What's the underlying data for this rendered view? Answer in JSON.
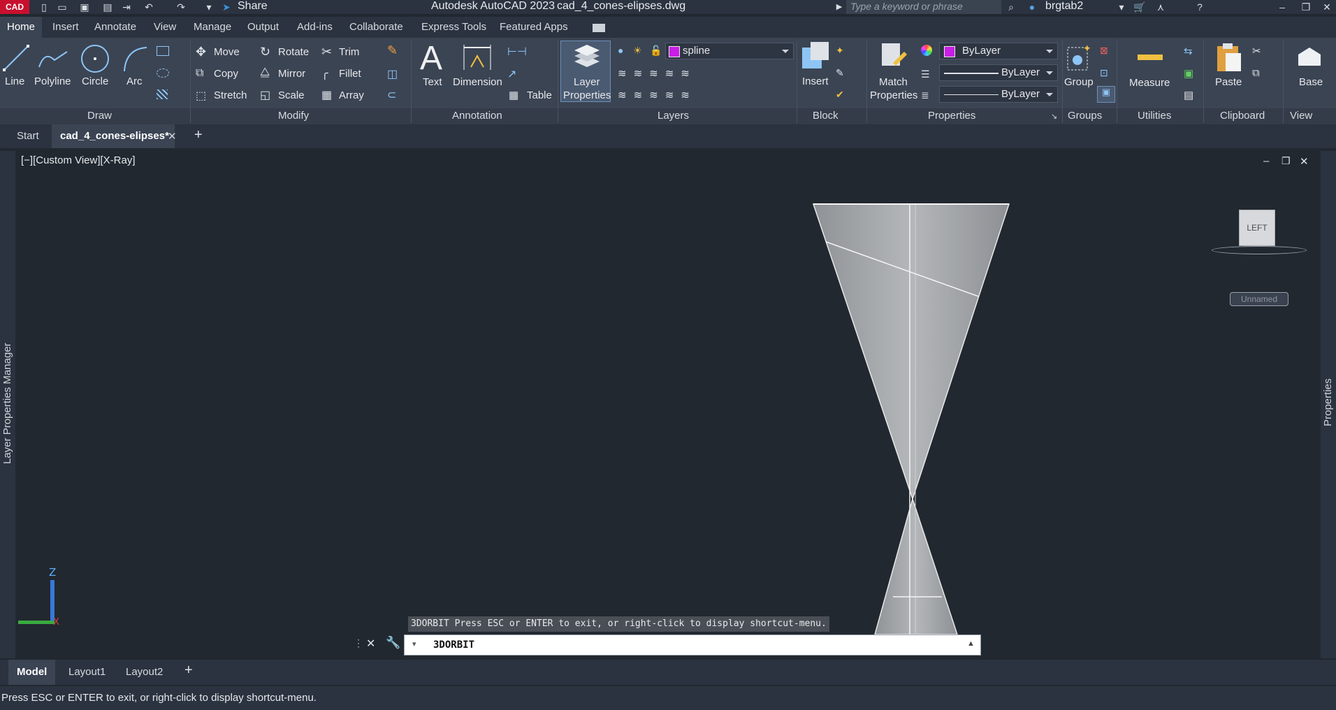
{
  "app": {
    "logo": "CAD",
    "title": "Autodesk AutoCAD 2023",
    "filename": "cad_4_cones-elipses.dwg",
    "share_label": "Share",
    "search_placeholder": "Type a keyword or phrase",
    "username": "brgtab2"
  },
  "ribbon_tabs": [
    "Home",
    "Insert",
    "Annotate",
    "View",
    "Manage",
    "Output",
    "Add-ins",
    "Collaborate",
    "Express Tools",
    "Featured Apps"
  ],
  "draw": {
    "line": "Line",
    "polyline": "Polyline",
    "circle": "Circle",
    "arc": "Arc",
    "panel": "Draw"
  },
  "modify": {
    "move": "Move",
    "rotate": "Rotate",
    "trim": "Trim",
    "copy": "Copy",
    "mirror": "Mirror",
    "fillet": "Fillet",
    "stretch": "Stretch",
    "scale": "Scale",
    "array": "Array",
    "panel": "Modify"
  },
  "annotation": {
    "text": "Text",
    "dimension": "Dimension",
    "table": "Table",
    "panel": "Annotation"
  },
  "layers": {
    "layer_properties_1": "Layer",
    "layer_properties_2": "Properties",
    "current_layer": "spline",
    "panel": "Layers"
  },
  "block": {
    "insert": "Insert",
    "panel": "Block"
  },
  "properties": {
    "match_1": "Match",
    "match_2": "Properties",
    "color": "ByLayer",
    "linetype": "ByLayer",
    "lineweight": "ByLayer",
    "panel": "Properties"
  },
  "groups": {
    "group": "Group",
    "panel": "Groups"
  },
  "utilities": {
    "measure": "Measure",
    "panel": "Utilities"
  },
  "clipboard": {
    "paste": "Paste",
    "panel": "Clipboard"
  },
  "view_panel": {
    "base": "Base",
    "panel": "View"
  },
  "file_tabs": {
    "start": "Start",
    "active": "cad_4_cones-elipses*"
  },
  "viewport": {
    "label": "[−][Custom View][X-Ray]",
    "viewcube_face": "LEFT",
    "ucs_name": "Unnamed",
    "axis_z": "Z",
    "left_palette": "Layer Properties Manager",
    "right_palette": "Properties"
  },
  "command": {
    "prompt_history": "3DORBIT Press ESC or ENTER to exit, or right-click to display shortcut-menu.",
    "current": "3DORBIT"
  },
  "layout_tabs": [
    "Model",
    "Layout1",
    "Layout2"
  ],
  "status_text": "Press ESC or ENTER to exit, or right-click to display shortcut-menu.",
  "colors": {
    "accent": "#3c8fd6",
    "layer_color": "#c81ee6",
    "logo_red": "#c8102e"
  }
}
